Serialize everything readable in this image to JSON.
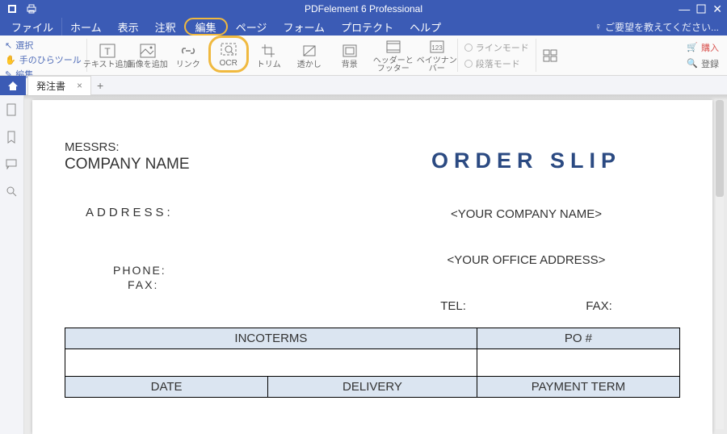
{
  "app": {
    "title": "PDFelement 6 Professional"
  },
  "menu": {
    "file": "ファイル",
    "home": "ホーム",
    "view": "表示",
    "annotate": "注釈",
    "edit": "編集",
    "page": "ページ",
    "form": "フォーム",
    "protect": "プロテクト",
    "help": "ヘルプ",
    "feedback": "ご要望を教えてください..."
  },
  "ribbon": {
    "select": "選択",
    "hand": "手のひらツール",
    "edit": "編集",
    "textadd": "テキスト追加",
    "imageadd": "画像を追加",
    "link": "リンク",
    "ocr": "OCR",
    "trim": "トリム",
    "watermark": "透かし",
    "background": "背景",
    "headerfooter": "ヘッダーとフッター",
    "bates": "ベイツナンバー",
    "linemode": "ラインモード",
    "paramode": "段落モード",
    "buy": "購入",
    "register": "登録"
  },
  "tab": {
    "name": "発注書"
  },
  "doc": {
    "messrs": "MESSRS:",
    "company": "COMPANY NAME",
    "address": "ADDRESS:",
    "phone": "PHONE:",
    "fax": "FAX:",
    "orderslip": "ORDER SLIP",
    "yourcompany": "<YOUR COMPANY NAME>",
    "youroffice": "<YOUR OFFICE ADDRESS>",
    "tel": "TEL:",
    "fax2": "FAX:",
    "tbl_incoterms": "INCOTERMS",
    "tbl_po": "PO #",
    "tbl_date": "DATE",
    "tbl_delivery": "DELIVERY",
    "tbl_payment": "PAYMENT TERM"
  }
}
